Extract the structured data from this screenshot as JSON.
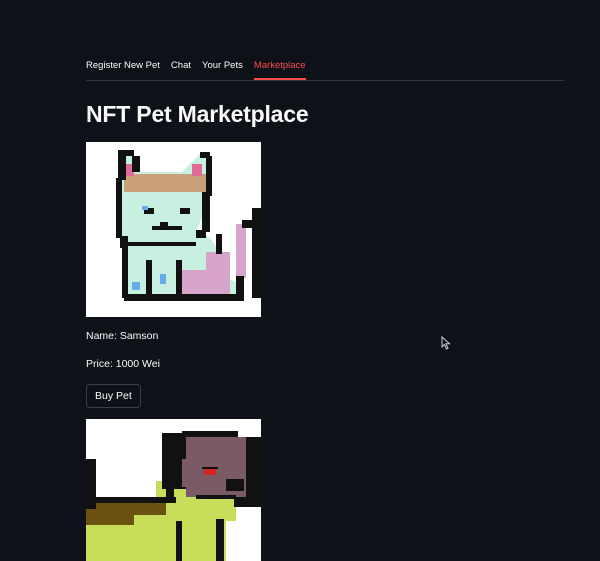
{
  "tabs": {
    "register": "Register New Pet",
    "chat": "Chat",
    "your_pets": "Your Pets",
    "marketplace": "Marketplace"
  },
  "active_tab": "Marketplace",
  "page_title": "NFT Pet Marketplace",
  "listings": [
    {
      "name_line": "Name: Samson",
      "price_line": "Price: 1000 Wei",
      "buy_label": "Buy Pet",
      "image": "pixel-art-cat"
    },
    {
      "image": "pixel-art-dog"
    }
  ],
  "colors": {
    "background": "#0e1117",
    "accent": "#ff4b4b",
    "text": "#fafafa"
  }
}
